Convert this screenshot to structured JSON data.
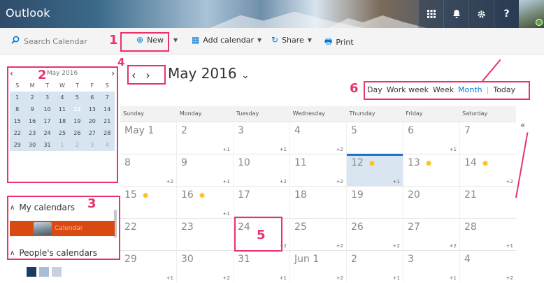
{
  "header": {
    "app_title": "Outlook",
    "icons": [
      "apps-grid-icon",
      "bell-icon",
      "gear-icon",
      "help-icon"
    ],
    "help_glyph": "?"
  },
  "toolbar": {
    "search_placeholder": "Search Calendar",
    "new_label": "New",
    "add_calendar_label": "Add calendar",
    "share_label": "Share",
    "print_label": "Print"
  },
  "mini_calendar": {
    "month_label": "May 2016",
    "dow": [
      "S",
      "M",
      "T",
      "W",
      "T",
      "F",
      "S"
    ],
    "weeks": [
      [
        "1",
        "2",
        "3",
        "4",
        "5",
        "6",
        "7"
      ],
      [
        "8",
        "9",
        "10",
        "11",
        "12",
        "13",
        "14"
      ],
      [
        "15",
        "16",
        "17",
        "18",
        "19",
        "20",
        "21"
      ],
      [
        "22",
        "23",
        "24",
        "25",
        "26",
        "27",
        "28"
      ],
      [
        "29",
        "30",
        "31",
        "1",
        "2",
        "3",
        "4"
      ]
    ],
    "today": "12"
  },
  "left": {
    "my_calendars_label": "My calendars",
    "calendar_item_label": "Calendar",
    "peoples_calendars_label": "People's calendars"
  },
  "main": {
    "title": "May 2016",
    "title_caret": "⌄",
    "views": [
      "Day",
      "Work week",
      "Week",
      "Month",
      "Today"
    ],
    "selected_view": "Month",
    "collapse_glyph": "«",
    "dow": [
      "Sunday",
      "Monday",
      "Tuesday",
      "Wednesday",
      "Thursday",
      "Friday",
      "Saturday"
    ],
    "weeks": [
      [
        {
          "d": "May 1",
          "more": ""
        },
        {
          "d": "2",
          "more": "+1"
        },
        {
          "d": "3",
          "more": "+1"
        },
        {
          "d": "4",
          "more": "+2"
        },
        {
          "d": "5",
          "more": ""
        },
        {
          "d": "6",
          "more": "+1"
        },
        {
          "d": "7",
          "more": ""
        }
      ],
      [
        {
          "d": "8",
          "more": "+2"
        },
        {
          "d": "9",
          "more": "+1"
        },
        {
          "d": "10",
          "more": "+2"
        },
        {
          "d": "11",
          "more": "+2"
        },
        {
          "d": "12",
          "more": "+1",
          "sun": true,
          "today": true
        },
        {
          "d": "13",
          "more": "",
          "sun": true
        },
        {
          "d": "14",
          "more": "+2",
          "sun": true
        }
      ],
      [
        {
          "d": "15",
          "more": "",
          "sun": true
        },
        {
          "d": "16",
          "more": "+1",
          "sun": true
        },
        {
          "d": "17",
          "more": ""
        },
        {
          "d": "18",
          "more": ""
        },
        {
          "d": "19",
          "more": ""
        },
        {
          "d": "20",
          "more": ""
        },
        {
          "d": "21",
          "more": ""
        }
      ],
      [
        {
          "d": "22",
          "more": ""
        },
        {
          "d": "23",
          "more": ""
        },
        {
          "d": "24",
          "more": "+2"
        },
        {
          "d": "25",
          "more": "+2"
        },
        {
          "d": "26",
          "more": "+2"
        },
        {
          "d": "27",
          "more": "+2"
        },
        {
          "d": "28",
          "more": "+1"
        }
      ],
      [
        {
          "d": "29",
          "more": "+1"
        },
        {
          "d": "30",
          "more": "+2"
        },
        {
          "d": "31",
          "more": "+1"
        },
        {
          "d": "Jun 1",
          "more": "+2"
        },
        {
          "d": "2",
          "more": "+1"
        },
        {
          "d": "3",
          "more": "+1"
        },
        {
          "d": "4",
          "more": "+2"
        }
      ]
    ]
  },
  "annotations": {
    "n1": "1",
    "n2": "2",
    "n3": "3",
    "n4": "4",
    "n5": "5",
    "n6": "6",
    "color": "#e8336b"
  },
  "colors": {
    "accent": "#0078d7",
    "today_fill": "#1a73c8",
    "calendar_item": "#d94a12",
    "sun": "#ffc21a"
  }
}
